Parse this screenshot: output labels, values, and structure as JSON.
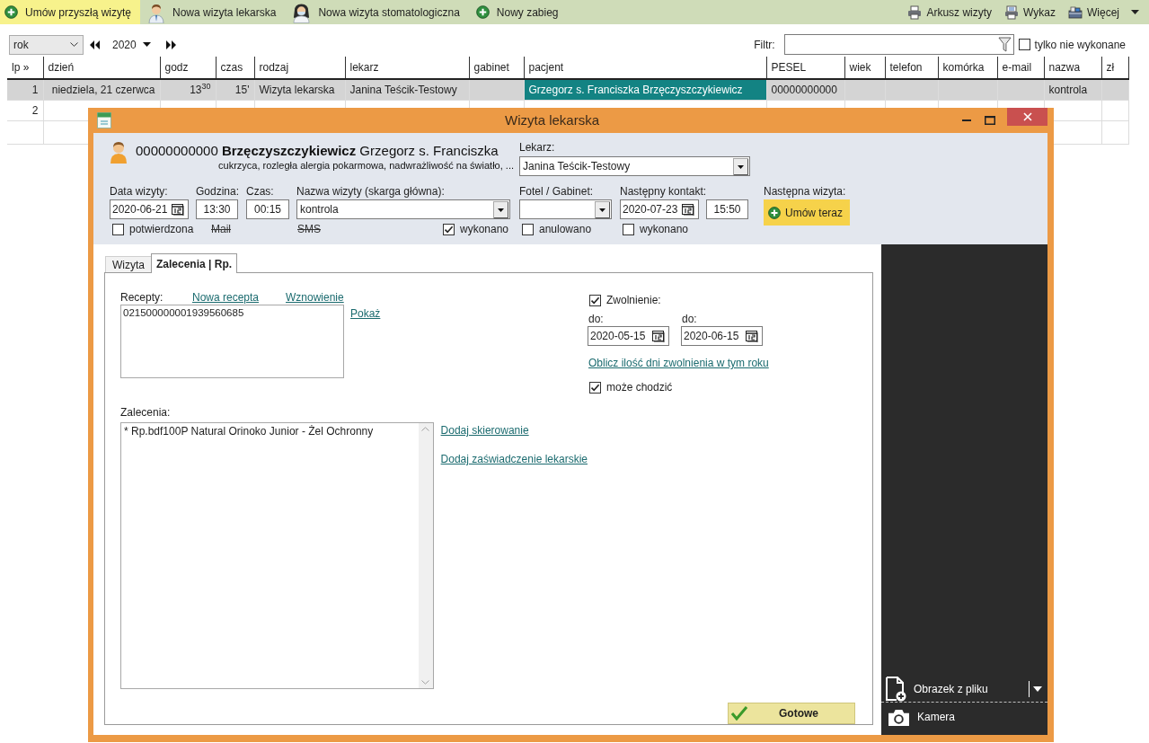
{
  "toolbar": {
    "items": [
      {
        "kind": "add",
        "label": "Umów przyszłą wizytę",
        "selected": true
      },
      {
        "kind": "doctor",
        "label": "Nowa wizyta lekarska",
        "selected": false
      },
      {
        "kind": "dentist",
        "label": "Nowa wizyta stomatologiczna",
        "selected": false
      },
      {
        "kind": "add",
        "label": "Nowy zabieg",
        "selected": false
      }
    ],
    "actions": [
      {
        "kind": "printer",
        "label": "Arkusz wizyty"
      },
      {
        "kind": "report",
        "label": "Wykaz"
      },
      {
        "kind": "more",
        "label": "Więcej"
      }
    ]
  },
  "period_bar": {
    "period": "rok",
    "year": "2020"
  },
  "filter": {
    "label": "Filtr:",
    "only_pending": {
      "label": "tylko nie wykonane",
      "checked": false
    }
  },
  "table": {
    "columns": [
      "lp »",
      "dzień",
      "godz",
      "czas",
      "rodzaj",
      "lekarz",
      "gabinet",
      "pacjent",
      "PESEL",
      "wiek",
      "telefon",
      "komórka",
      "e-mail",
      "nazwa",
      "zł"
    ],
    "rows": [
      {
        "selected": true,
        "lp": "1",
        "dzien": "niedziela, 21 czerwca",
        "godz": "13$^{30}$",
        "czas": "15'",
        "rodzaj": "Wizyta lekarska",
        "lekarz": "Janina Teścik-Testowy",
        "pacjent": {
          "text": "Grzegorz s. Franciszka Brzęczyszczykiewicz",
          "focused": true
        },
        "pesel": "00000000000",
        "nazwa": "kontrola"
      },
      {
        "selected": false,
        "lp": "2"
      }
    ]
  },
  "dialog": {
    "title": "Wizyta lekarska",
    "patient": {
      "line": "00000000000 **Brzęczyszczykiewicz** Grzegorz s. Franciszka",
      "notes": "cukrzyca, rozległa alergia pokarmowa, nadwrażliwość na światło, ..."
    },
    "doctor": {
      "label": "Lekarz:",
      "value": "Janina Teścik-Testowy"
    },
    "visit_date": {
      "label": "Data wizyty:",
      "value": "2020-06-21"
    },
    "time": {
      "label": "Godzina:",
      "value": "13:30"
    },
    "duration": {
      "label": "Czas:",
      "value": "00:15"
    },
    "visit_name": {
      "label": "Nazwa wizyty (skarga główna):",
      "value": "kontrola"
    },
    "chair": {
      "label": "Fotel / Gabinet:"
    },
    "next_contact": {
      "label": "Następny kontakt:",
      "date": "2020-07-23",
      "time": "15:50"
    },
    "next_visit": {
      "label": "Następna wizyta:",
      "button": "Umów teraz"
    },
    "flags": [
      {
        "kind": "checkbox",
        "label": "potwierdzona",
        "checked": false
      },
      {
        "kind": "struck",
        "label": "Mail"
      },
      {
        "kind": "struck",
        "label": "SMS"
      },
      {
        "kind": "checkbox",
        "label": "wykonano",
        "checked": true
      },
      {
        "kind": "checkbox",
        "label": "anulowano",
        "checked": false
      },
      {
        "kind": "checkbox",
        "label": "wykonano",
        "checked": false
      }
    ],
    "tabs": [
      {
        "label": "Wizyta",
        "selected": false
      },
      {
        "label": "Zalecenia | Rp.",
        "selected": true
      }
    ],
    "prescriptions": {
      "label": "Recepty:",
      "links": [
        "Nowa recepta",
        "Wznowienie"
      ],
      "items": [
        "021500000001939560685"
      ],
      "show_link": "Pokaż"
    },
    "sick_leave": {
      "label": "Zwolnienie:",
      "checked": true,
      "from": {
        "label": "do:",
        "value": "2020-05-15"
      },
      "to": {
        "label": "do:",
        "value": "2020-06-15"
      },
      "count_link": "Oblicz ilość dni zwolnienia w tym roku",
      "can_walk": {
        "label": "może chodzić",
        "checked": true
      }
    },
    "recommendations": {
      "label": "Zalecenia:",
      "text": "* Rp.bdf100P Natural Orinoko Junior - Żel Ochronny",
      "links": [
        "Dodaj skierowanie",
        "Dodaj zaświadczenie lekarskie"
      ]
    },
    "done_button": "Gotowe",
    "side_panel": [
      {
        "kind": "file",
        "label": "Obrazek z pliku"
      },
      {
        "kind": "camera",
        "label": "Kamera"
      }
    ]
  }
}
